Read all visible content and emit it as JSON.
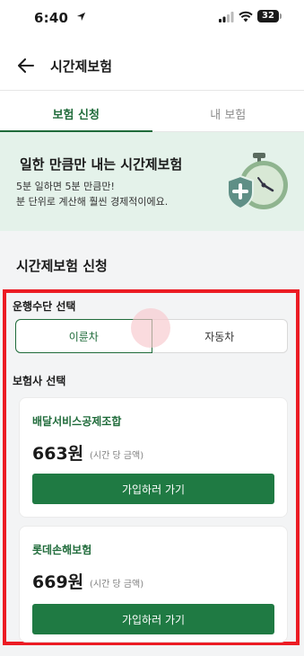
{
  "status_bar": {
    "time": "6:40",
    "battery": "32"
  },
  "header": {
    "title": "시간제보험"
  },
  "tabs": [
    {
      "label": "보험 신청",
      "active": true
    },
    {
      "label": "내 보험",
      "active": false
    }
  ],
  "banner": {
    "title": "일한 만큼만 내는 시간제보험",
    "description": "5분 일하면 5분 만큼만!\n분 단위로 계산해 훨씬 경제적이에요."
  },
  "section": {
    "title": "시간제보험 신청"
  },
  "vehicle": {
    "label": "운행수단 선택",
    "options": [
      "이륜차",
      "자동차"
    ],
    "selected": "이륜차"
  },
  "insurer": {
    "label": "보험사 선택",
    "cards": [
      {
        "name": "배달서비스공제조합",
        "price": "663원",
        "unit": "(시간 당 금액)",
        "button": "가입하러 가기"
      },
      {
        "name": "롯데손해보험",
        "price": "669원",
        "unit": "(시간 당 금액)",
        "button": "가입하러 가기"
      }
    ]
  },
  "colors": {
    "brand_green": "#1f6b3a",
    "button_green": "#1f7a43",
    "banner_bg": "#e4f2ea",
    "highlight_red": "#ec1c24"
  }
}
